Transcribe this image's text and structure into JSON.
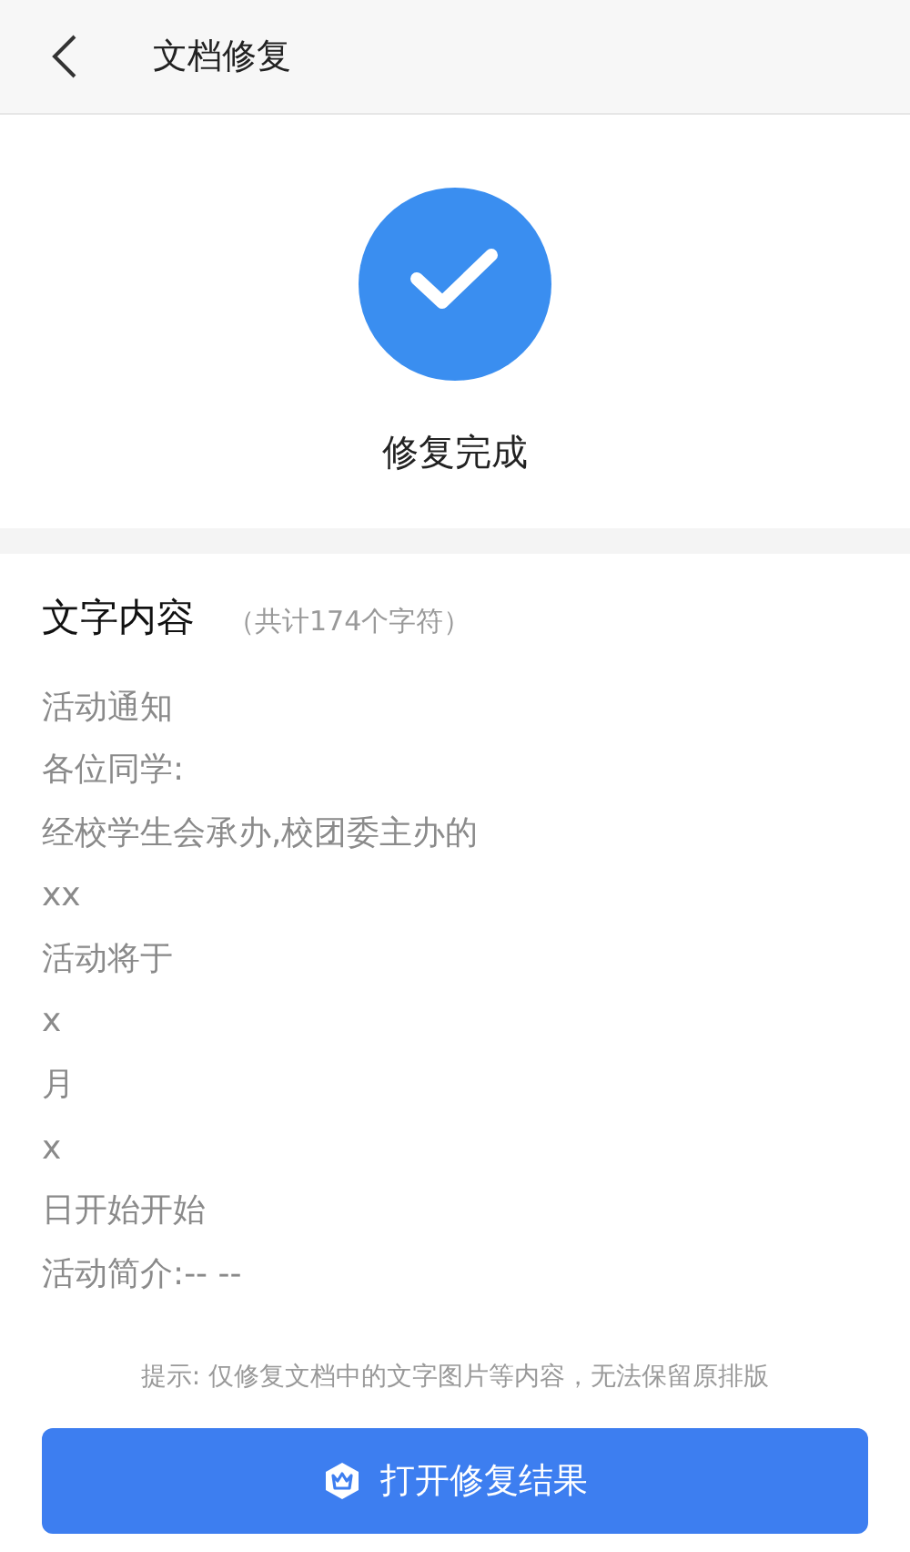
{
  "header": {
    "title": "文档修复"
  },
  "result": {
    "status": "修复完成"
  },
  "content": {
    "heading": "文字内容",
    "count": "（共计174个字符）",
    "lines": [
      "活动通知",
      "各位同学:",
      "经校学生会承办,校团委主办的",
      "xx",
      "活动将于",
      "x",
      "月",
      "x",
      "日开始开始",
      "活动简介:-- --"
    ]
  },
  "hint": "提示: 仅修复文档中的文字图片等内容，无法保留原排版",
  "button": {
    "label": "打开修复结果"
  }
}
